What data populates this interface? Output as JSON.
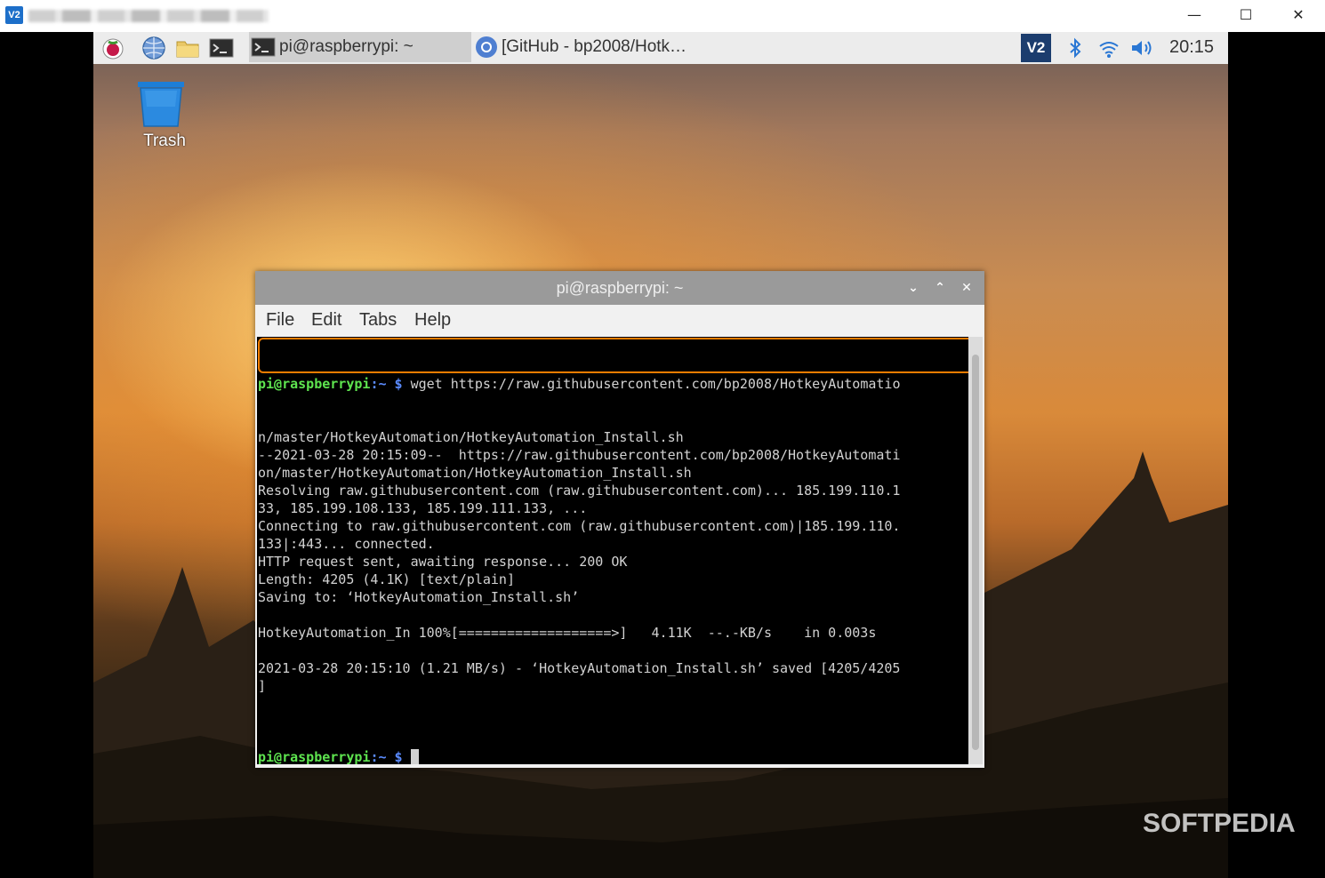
{
  "vnc_window": {
    "logo": "V2",
    "controls": {
      "minimize": "—",
      "maximize": "☐",
      "close": "✕"
    }
  },
  "panel": {
    "tasks": [
      {
        "label": "pi@raspberrypi: ~",
        "icon": "terminal-icon",
        "active": true
      },
      {
        "label": "[GitHub - bp2008/Hotk…",
        "icon": "chromium-icon",
        "active": false
      }
    ],
    "tray": {
      "vnc_icon": "V2",
      "clock": "20:15"
    }
  },
  "desktop": {
    "trash_label": "Trash"
  },
  "terminal": {
    "title": "pi@raspberrypi: ~",
    "menu": [
      "File",
      "Edit",
      "Tabs",
      "Help"
    ],
    "prompt_user": "pi@raspberrypi",
    "prompt_path": ":~ $",
    "command": " wget https://raw.githubusercontent.com/bp2008/HotkeyAutomatio",
    "output": [
      "n/master/HotkeyAutomation/HotkeyAutomation_Install.sh",
      "--2021-03-28 20:15:09--  https://raw.githubusercontent.com/bp2008/HotkeyAutomati",
      "on/master/HotkeyAutomation/HotkeyAutomation_Install.sh",
      "Resolving raw.githubusercontent.com (raw.githubusercontent.com)... 185.199.110.1",
      "33, 185.199.108.133, 185.199.111.133, ...",
      "Connecting to raw.githubusercontent.com (raw.githubusercontent.com)|185.199.110.",
      "133|:443... connected.",
      "HTTP request sent, awaiting response... 200 OK",
      "Length: 4205 (4.1K) [text/plain]",
      "Saving to: ‘HotkeyAutomation_Install.sh’",
      "",
      "HotkeyAutomation_In 100%[===================>]   4.11K  --.-KB/s    in 0.003s",
      "",
      "2021-03-28 20:15:10 (1.21 MB/s) - ‘HotkeyAutomation_Install.sh’ saved [4205/4205",
      "]",
      ""
    ]
  },
  "watermark": "SOFTPEDIA"
}
